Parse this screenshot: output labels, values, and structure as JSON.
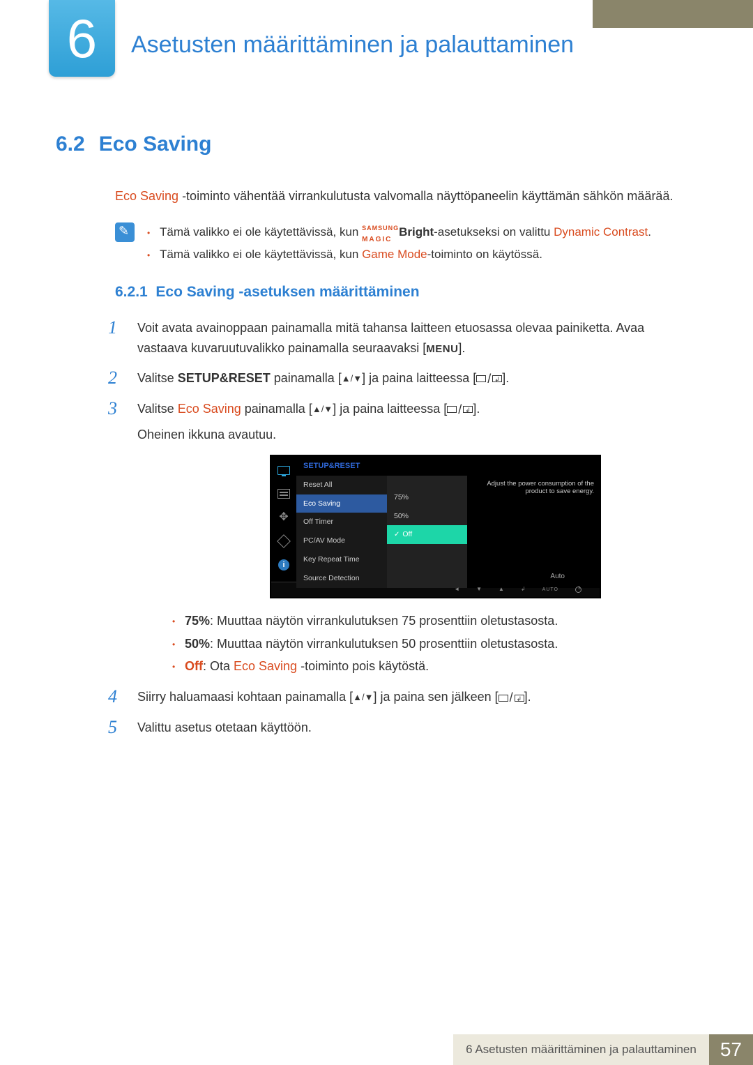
{
  "chapter": {
    "number": "6",
    "title": "Asetusten määrittäminen ja palauttaminen"
  },
  "section": {
    "num": "6.2",
    "title": "Eco Saving"
  },
  "intro": {
    "feature": "Eco Saving",
    "text_after": " -toiminto vähentää virrankulutusta valvomalla näyttöpaneelin käyttämän sähkön määrää."
  },
  "notes": {
    "n1_a": "Tämä valikko ei ole käytettävissä, kun ",
    "samsung": "SAMSUNG",
    "magic": "MAGIC",
    "bright": "Bright",
    "n1_b": "-asetukseksi on valittu ",
    "dyn": "Dynamic Contrast",
    "n2_a": "Tämä valikko ei ole käytettävissä, kun ",
    "game": "Game Mode",
    "n2_b": "-toiminto on käytössä."
  },
  "subsec": {
    "num": "6.2.1",
    "title": "Eco Saving -asetuksen määrittäminen"
  },
  "steps": {
    "s1": {
      "num": "1",
      "a": "Voit avata avainoppaan painamalla mitä tahansa laitteen etuosassa olevaa painiketta. Avaa vastaava kuvaruutuvalikko painamalla seuraavaksi [",
      "menu": "MENU",
      "b": "]."
    },
    "s2": {
      "num": "2",
      "a": "Valitse ",
      "setup": "SETUP&RESET",
      "b": " painamalla [",
      "c": "] ja paina laitteessa [",
      "d": "]."
    },
    "s3": {
      "num": "3",
      "a": "Valitse ",
      "eco": "Eco Saving",
      "b": " painamalla [",
      "c": "] ja paina laitteessa [",
      "d": "].",
      "e": "Oheinen ikkuna avautuu."
    },
    "s4": {
      "num": "4",
      "a": "Siirry haluamaasi kohtaan painamalla [",
      "b": "] ja paina sen jälkeen [",
      "c": "]."
    },
    "s5": {
      "num": "5",
      "a": "Valittu asetus otetaan käyttöön."
    }
  },
  "osd": {
    "title": "SETUP&RESET",
    "menu": [
      "Reset All",
      "Eco Saving",
      "Off Timer",
      "PC/AV Mode",
      "Key Repeat Time",
      "Source Detection"
    ],
    "menu_selected": 1,
    "sub": [
      "75%",
      "50%",
      "Off"
    ],
    "sub_selected": 2,
    "desc": "Adjust the power consumption of the product to save energy.",
    "auto": "Auto",
    "bottom_auto": "AUTO"
  },
  "bullets": {
    "b1_a": "75%",
    "b1_b": ": Muuttaa näytön virrankulutuksen 75 prosenttiin oletustasosta.",
    "b2_a": "50%",
    "b2_b": ": Muuttaa näytön virrankulutuksen 50 prosenttiin oletustasosta.",
    "b3_a": "Off",
    "b3_b": ": Ota ",
    "b3_eco": "Eco Saving",
    "b3_c": " -toiminto pois käytöstä."
  },
  "footer": {
    "text": "6 Asetusten määrittäminen ja palauttaminen",
    "page": "57"
  }
}
